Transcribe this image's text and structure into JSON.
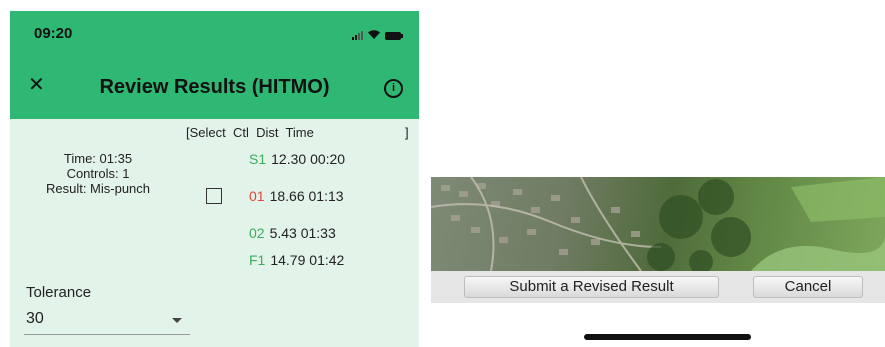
{
  "status_bar": {
    "time": "09:20"
  },
  "header": {
    "title": "Review Results (HITMO)"
  },
  "table": {
    "header": "[Select  Ctl  Dist  Time",
    "header_end": "]",
    "rows": [
      {
        "ctl": "S1",
        "dist": "12.30",
        "time": "00:20"
      },
      {
        "ctl": "01",
        "dist": "18.66",
        "time": "01:13"
      },
      {
        "ctl": "02",
        "dist": "5.43",
        "time": "01:33"
      },
      {
        "ctl": "F1",
        "dist": "14.79",
        "time": "01:42"
      }
    ]
  },
  "summary": {
    "time": "Time: 01:35",
    "controls": "Controls: 1",
    "result": "Result: Mis-punch"
  },
  "tolerance": {
    "label": "Tolerance",
    "value": "30"
  },
  "buttons": {
    "submit": "Submit a Revised Result",
    "cancel": "Cancel"
  },
  "colors": {
    "header_bg": "#2fb874",
    "body_bg": "#e2f3ea",
    "ok": "#3cad5e",
    "error": "#e0463c"
  },
  "icons": [
    "close-icon",
    "info-icon",
    "signal-icon",
    "wifi-icon",
    "battery-icon",
    "dropdown-icon"
  ]
}
